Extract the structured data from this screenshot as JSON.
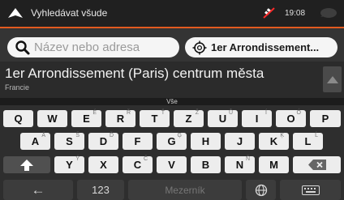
{
  "status_bar": {
    "title": "Vyhledávat všude",
    "time": "19:08",
    "icons": [
      "navigation-arrow-icon",
      "no-gps-signal-icon",
      "message-icon"
    ]
  },
  "search": {
    "placeholder": "Název nebo adresa",
    "location_label": "1er Arrondissement...",
    "icons": [
      "search-icon",
      "location-target-icon"
    ]
  },
  "result": {
    "title": "1er Arrondissement (Paris) centrum města",
    "subtitle": "Francie"
  },
  "filter_label": "Vše",
  "keyboard": {
    "row1": [
      {
        "key": "Q",
        "sup": ""
      },
      {
        "key": "W",
        "sup": ""
      },
      {
        "key": "E",
        "sup": "É"
      },
      {
        "key": "R",
        "sup": "Ř"
      },
      {
        "key": "T",
        "sup": "Ť"
      },
      {
        "key": "Z",
        "sup": "Ž"
      },
      {
        "key": "U",
        "sup": "Ů"
      },
      {
        "key": "I",
        "sup": "Í"
      },
      {
        "key": "O",
        "sup": "Ó"
      },
      {
        "key": "P",
        "sup": ""
      }
    ],
    "row2": [
      {
        "key": "A",
        "sup": "Á"
      },
      {
        "key": "S",
        "sup": "Š"
      },
      {
        "key": "D",
        "sup": "Ď"
      },
      {
        "key": "F",
        "sup": ""
      },
      {
        "key": "G",
        "sup": "Ģ"
      },
      {
        "key": "H",
        "sup": ""
      },
      {
        "key": "J",
        "sup": ""
      },
      {
        "key": "K",
        "sup": "Ķ"
      },
      {
        "key": "L",
        "sup": "Ĺ"
      }
    ],
    "row3": [
      {
        "key": "Y",
        "sup": "Ý"
      },
      {
        "key": "X",
        "sup": ""
      },
      {
        "key": "C",
        "sup": "Č"
      },
      {
        "key": "V",
        "sup": ""
      },
      {
        "key": "B",
        "sup": ""
      },
      {
        "key": "N",
        "sup": "Ň"
      },
      {
        "key": "M",
        "sup": ""
      }
    ],
    "back_label": "←",
    "numbers_label": "123",
    "space_label": "Mezerník",
    "icons": [
      "shift-icon",
      "backspace-icon",
      "globe-icon",
      "keyboard-icon"
    ]
  },
  "colors": {
    "accent": "#e35a1f",
    "key_bg": "#ededed",
    "background": "#1e1e1e"
  }
}
